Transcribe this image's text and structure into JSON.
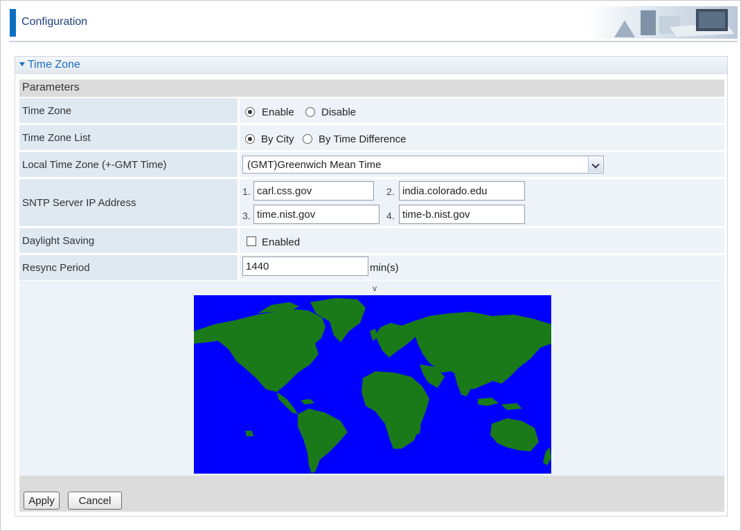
{
  "header": {
    "title": "Configuration"
  },
  "panel": {
    "title": "Time Zone",
    "params_heading": "Parameters"
  },
  "time_zone": {
    "label": "Time Zone",
    "options": [
      "Enable",
      "Disable"
    ],
    "selected": "Enable"
  },
  "time_zone_list": {
    "label": "Time Zone List",
    "options": [
      "By City",
      "By Time Difference"
    ],
    "selected": "By City"
  },
  "local_time_zone": {
    "label": "Local Time Zone (+-GMT Time)",
    "value": "(GMT)Greenwich Mean Time"
  },
  "sntp": {
    "label": "SNTP Server IP Address",
    "servers": [
      {
        "num": "1.",
        "value": "carl.css.gov"
      },
      {
        "num": "2.",
        "value": "india.colorado.edu"
      },
      {
        "num": "3.",
        "value": "time.nist.gov"
      },
      {
        "num": "4.",
        "value": "time-b.nist.gov"
      }
    ]
  },
  "daylight": {
    "label": "Daylight Saving",
    "checkbox_label": "Enabled",
    "checked": false
  },
  "resync": {
    "label": "Resync Period",
    "value": "1440",
    "unit": "min(s)"
  },
  "map": {
    "marker": "v",
    "ocean_color": "#0000ff",
    "land_color": "#1a7a1a"
  },
  "buttons": {
    "apply": "Apply",
    "cancel": "Cancel"
  }
}
